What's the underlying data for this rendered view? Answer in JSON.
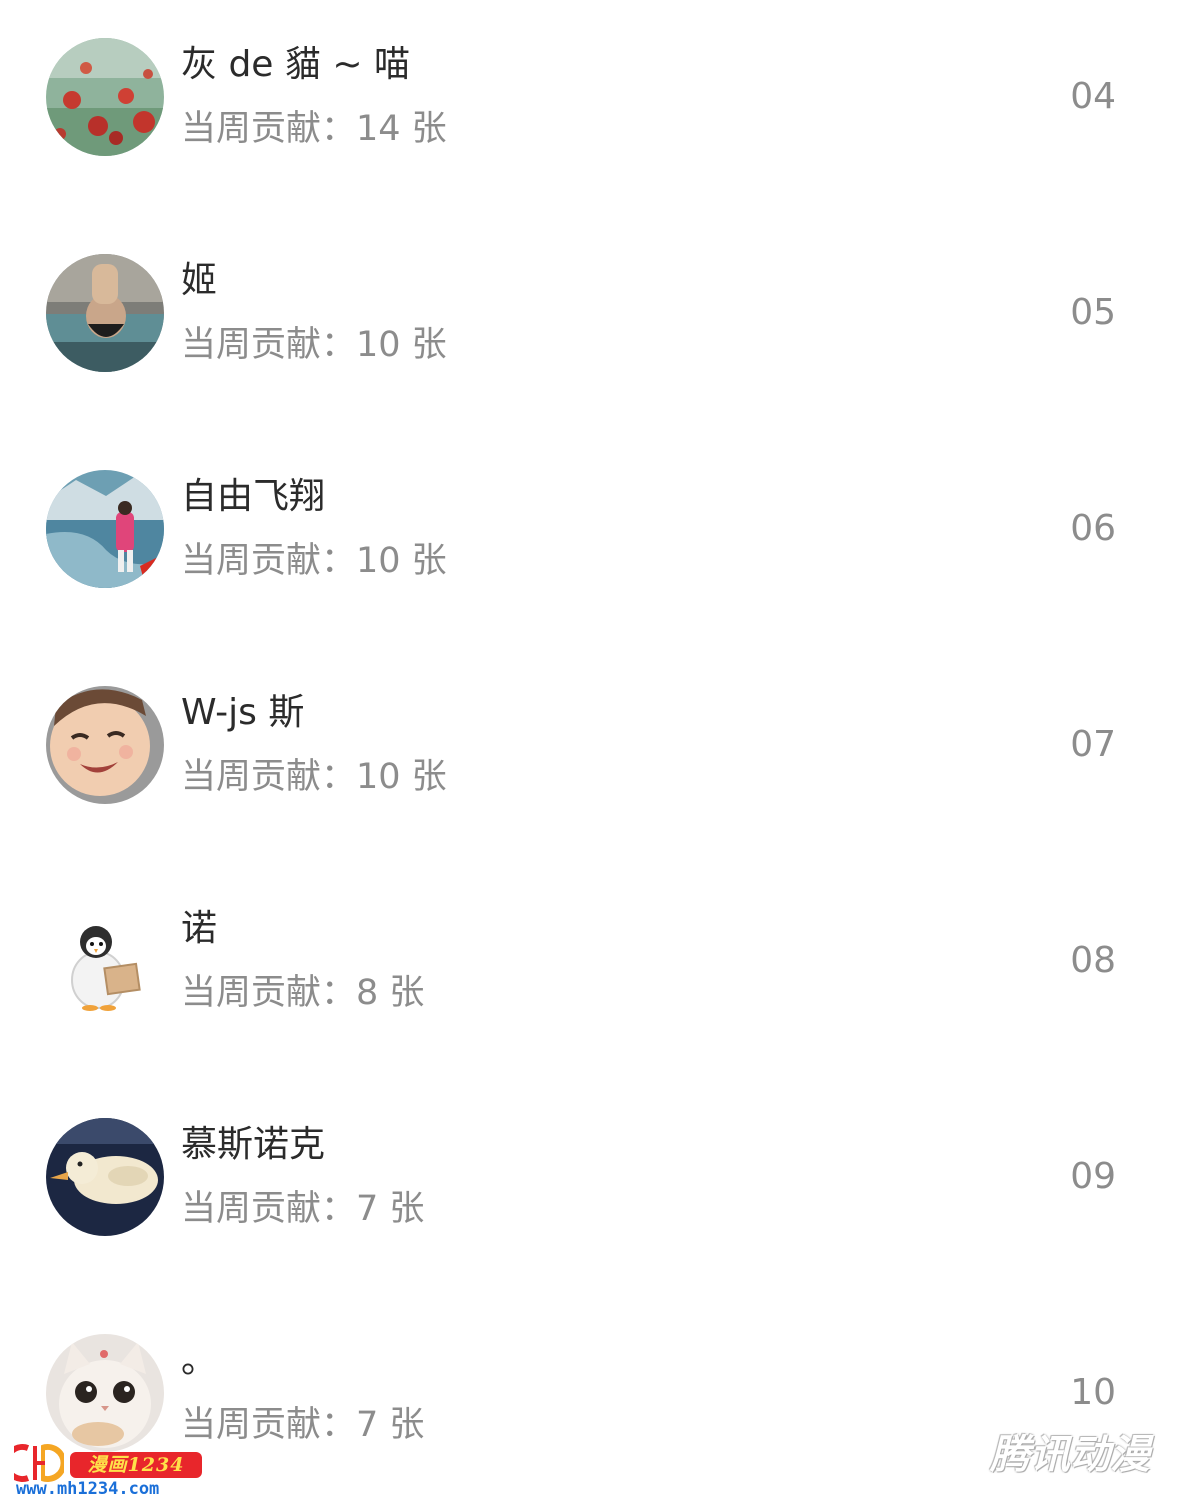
{
  "ranking": {
    "items": [
      {
        "name": "灰 de 貓 ~ 喵",
        "contribution": "当周贡献：14 张",
        "rank": "04",
        "avatar_icon": "poppy-field-avatar-icon"
      },
      {
        "name": "姬",
        "contribution": "当周贡献：10 张",
        "rank": "05",
        "avatar_icon": "poolside-avatar-icon"
      },
      {
        "name": "自由飞翔",
        "contribution": "当周贡献：10 张",
        "rank": "06",
        "avatar_icon": "waterfall-flag-avatar-icon"
      },
      {
        "name": "W-js 斯",
        "contribution": "当周贡献：10 张",
        "rank": "07",
        "avatar_icon": "smiling-child-avatar-icon"
      },
      {
        "name": "诺",
        "contribution": "当周贡献：8 张",
        "rank": "08",
        "avatar_icon": "penguin-avatar-icon"
      },
      {
        "name": "慕斯诺克",
        "contribution": "当周贡献：7 张",
        "rank": "09",
        "avatar_icon": "duck-avatar-icon"
      },
      {
        "name": "。",
        "contribution": "当周贡献：7 张",
        "rank": "10",
        "avatar_icon": "white-cat-avatar-icon"
      }
    ]
  },
  "watermarks": {
    "left_badge": "漫画1234",
    "left_url": "www.mh1234.com",
    "right_text": "腾讯动漫"
  },
  "colors": {
    "name_text": "#2b2b2b",
    "secondary_text": "#8c8c8c",
    "background": "#ffffff"
  }
}
